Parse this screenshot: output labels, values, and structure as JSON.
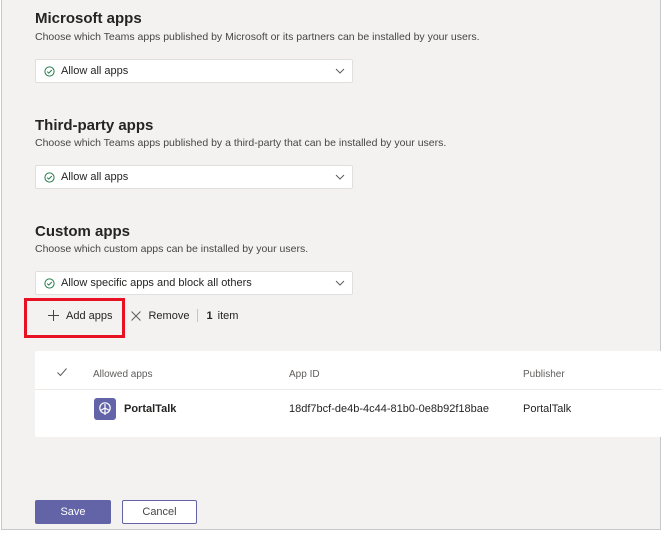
{
  "microsoft_apps": {
    "title": "Microsoft apps",
    "description": "Choose which Teams apps published by Microsoft or its partners can be installed by your users.",
    "selected": "Allow all apps"
  },
  "third_party_apps": {
    "title": "Third-party apps",
    "description": "Choose which Teams apps published by a third-party that can be installed by your users.",
    "selected": "Allow all apps"
  },
  "custom_apps": {
    "title": "Custom apps",
    "description": "Choose which custom apps can be installed by your users.",
    "selected": "Allow specific apps and block all others"
  },
  "command_bar": {
    "add_label": "Add apps",
    "remove_label": "Remove",
    "count": "1",
    "count_suffix": "item"
  },
  "table": {
    "columns": [
      "Allowed apps",
      "App ID",
      "Publisher"
    ],
    "rows": [
      {
        "name": "PortalTalk",
        "app_id": "18df7bcf-de4b-4c44-81b0-0e8b92f18bae",
        "publisher": "PortalTalk",
        "icon": "portaltalk-app-icon"
      }
    ]
  },
  "footer": {
    "save_label": "Save",
    "cancel_label": "Cancel"
  },
  "colors": {
    "accent": "#6264a7",
    "success": "#237b4b",
    "highlight": "#e81123"
  }
}
